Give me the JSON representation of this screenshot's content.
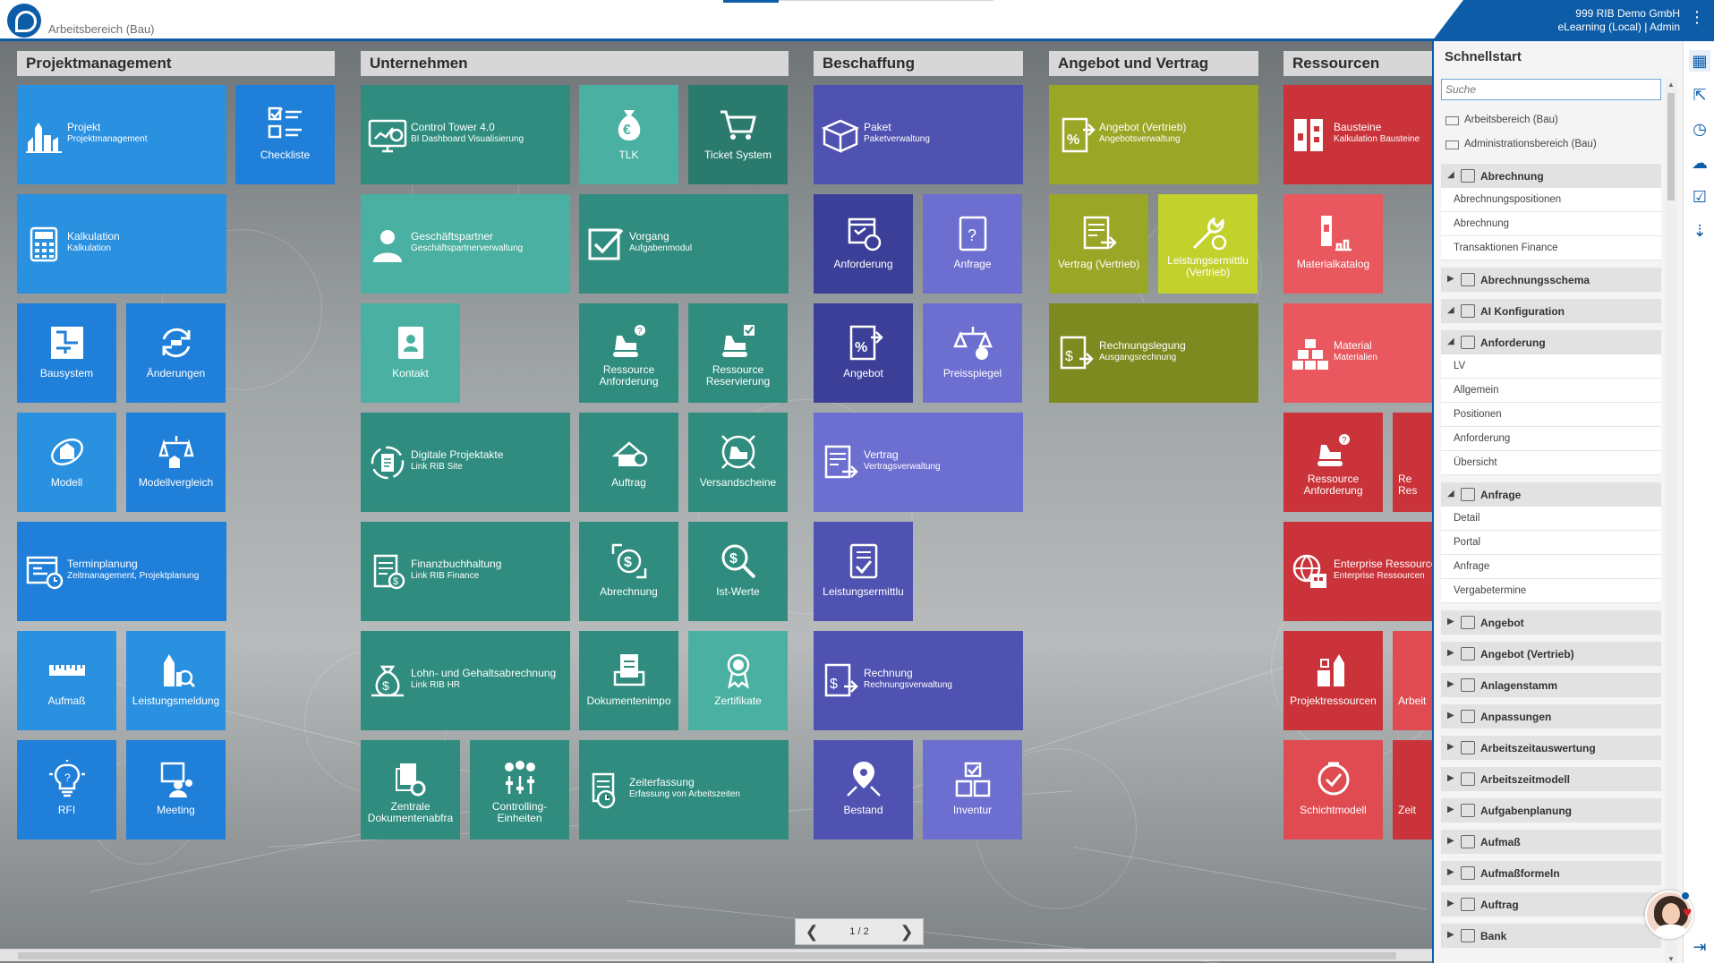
{
  "header": {
    "app_title": "Arbeitsbereich (Bau)",
    "company": "999 RIB Demo GmbH",
    "context": "eLearning (Local) | Admin",
    "menu_icon": "more-vertical-icon"
  },
  "groups": [
    {
      "name": "Projektmanagement"
    },
    {
      "name": "Unternehmen"
    },
    {
      "name": "Beschaffung"
    },
    {
      "name": "Angebot und Vertrag"
    },
    {
      "name": "Ressourcen"
    }
  ],
  "tiles": {
    "projekt": {
      "title": "Projekt",
      "subtitle": "Projektmanagement"
    },
    "checkliste": {
      "label": "Checkliste"
    },
    "kalkulation": {
      "title": "Kalkulation",
      "subtitle": "Kalkulation"
    },
    "bausystem": {
      "label": "Bausystem"
    },
    "aenderungen": {
      "label": "Änderungen"
    },
    "modell": {
      "label": "Modell"
    },
    "modellvergleich": {
      "label": "Modellvergleich"
    },
    "terminplanung": {
      "title": "Terminplanung",
      "subtitle": "Zeitmanagement, Projektplanung"
    },
    "aufmass": {
      "label": "Aufmaß"
    },
    "leistungsmeldung": {
      "label": "Leistungsmeldung"
    },
    "rfi": {
      "label": "RFI"
    },
    "meeting": {
      "label": "Meeting"
    },
    "control_tower": {
      "title": "Control Tower 4.0",
      "subtitle": "BI Dashboard Visualisierung"
    },
    "tlk": {
      "label": "TLK"
    },
    "ticket_system": {
      "label": "Ticket System"
    },
    "geschaeftspartner": {
      "title": "Geschäftspartner",
      "subtitle": "Geschäftspartnerverwaltung"
    },
    "vorgang": {
      "title": "Vorgang",
      "subtitle": "Aufgabenmodul"
    },
    "kontakt": {
      "label": "Kontakt"
    },
    "ressource_anforderung_u": {
      "label": "Ressource Anforderung"
    },
    "ressource_reservierung": {
      "label": "Ressource Reservierung"
    },
    "digitale_projektakte": {
      "title": "Digitale Projektakte",
      "subtitle": "Link RIB Site"
    },
    "auftrag_u": {
      "label": "Auftrag"
    },
    "versandscheine": {
      "label": "Versandscheine"
    },
    "finanzbuchhaltung": {
      "title": "Finanzbuchhaltung",
      "subtitle": "Link RIB Finance"
    },
    "abrechnung": {
      "label": "Abrechnung"
    },
    "ist_werte": {
      "label": "Ist-Werte"
    },
    "lohn": {
      "title": "Lohn- und Gehaltsabrechnung",
      "subtitle": "Link RIB HR"
    },
    "dokumentenimport": {
      "label": "Dokumentenimpo"
    },
    "zertifikate": {
      "label": "Zertifikate"
    },
    "zentrale_dok": {
      "label": "Zentrale Dokumentenabfra"
    },
    "controlling": {
      "label": "Controlling-Einheiten"
    },
    "zeiterfassung": {
      "title": "Zeiterfassung",
      "subtitle": "Erfassung von Arbeitszeiten"
    },
    "paket": {
      "title": "Paket",
      "subtitle": "Paketverwaltung"
    },
    "anforderung": {
      "label": "Anforderung"
    },
    "anfrage": {
      "label": "Anfrage"
    },
    "angebot": {
      "label": "Angebot"
    },
    "preisspiegel": {
      "label": "Preisspiegel"
    },
    "vertrag": {
      "title": "Vertrag",
      "subtitle": "Vertragsverwaltung"
    },
    "leistungsermittlung_b": {
      "label": "Leistungsermittlu"
    },
    "rechnung": {
      "title": "Rechnung",
      "subtitle": "Rechnungsverwaltung"
    },
    "bestand": {
      "label": "Bestand"
    },
    "inventur": {
      "label": "Inventur"
    },
    "angebot_vertrieb": {
      "title": "Angebot (Vertrieb)",
      "subtitle": "Angebotsverwaltung"
    },
    "vertrag_vertrieb": {
      "label": "Vertrag (Vertrieb)"
    },
    "leistungsermittlung_v": {
      "label": "Leistungsermittlu (Vertrieb)"
    },
    "rechnungslegung": {
      "title": "Rechnungslegung",
      "subtitle": "Ausgangsrechnung"
    },
    "bausteine": {
      "title": "Bausteine",
      "subtitle": "Kalkulation Bausteine"
    },
    "materialkatalog": {
      "label": "Materialkatalog"
    },
    "material": {
      "title": "Material",
      "subtitle": "Materialien"
    },
    "ressource_anforderung_r": {
      "label": "Ressource Anforderung"
    },
    "ressource_res_r": {
      "label": "Re Res"
    },
    "enterprise": {
      "title": "Enterprise Ressource",
      "subtitle": "Enterprise Ressourcen"
    },
    "projektressourcen": {
      "label": "Projektressourcen"
    },
    "arbeit": {
      "label": "Arbeit"
    },
    "schichtmodell": {
      "label": "Schichtmodell"
    },
    "zeit": {
      "label": "Zeit"
    }
  },
  "pager": {
    "prev": "❮",
    "page": "1 / 2",
    "next": "❯"
  },
  "quickstart": {
    "title": "Schnellstart",
    "search_placeholder": "Suche",
    "links": [
      "Arbeitsbereich (Bau)",
      "Administrationsbereich (Bau)"
    ],
    "categories": [
      {
        "name": "Abrechnung",
        "expanded": true,
        "items": [
          "Abrechnungspositionen",
          "Abrechnung",
          "Transaktionen Finance"
        ]
      },
      {
        "name": "Abrechnungsschema",
        "expanded": false,
        "items": []
      },
      {
        "name": "AI Konfiguration",
        "expanded": true,
        "items": []
      },
      {
        "name": "Anforderung",
        "expanded": true,
        "items": [
          "LV",
          "Allgemein",
          "Positionen",
          "Anforderung",
          "Übersicht"
        ]
      },
      {
        "name": "Anfrage",
        "expanded": true,
        "items": [
          "Detail",
          "Portal",
          "Anfrage",
          "Vergabetermine"
        ]
      },
      {
        "name": "Angebot",
        "expanded": false,
        "items": []
      },
      {
        "name": "Angebot (Vertrieb)",
        "expanded": false,
        "items": []
      },
      {
        "name": "Anlagenstamm",
        "expanded": false,
        "items": []
      },
      {
        "name": "Anpassungen",
        "expanded": false,
        "items": []
      },
      {
        "name": "Arbeitszeitauswertung",
        "expanded": false,
        "items": []
      },
      {
        "name": "Arbeitszeitmodell",
        "expanded": false,
        "items": []
      },
      {
        "name": "Aufgabenplanung",
        "expanded": false,
        "items": []
      },
      {
        "name": "Aufmaß",
        "expanded": false,
        "items": []
      },
      {
        "name": "Aufmaßformeln",
        "expanded": false,
        "items": []
      },
      {
        "name": "Auftrag",
        "expanded": false,
        "items": []
      },
      {
        "name": "Bank",
        "expanded": false,
        "items": []
      }
    ]
  },
  "rail": [
    "grid-icon",
    "share-icon",
    "clock-icon",
    "cloud-icon",
    "checkbox-icon",
    "download-icon"
  ],
  "colors": {
    "brand": "#0d5ca8"
  }
}
